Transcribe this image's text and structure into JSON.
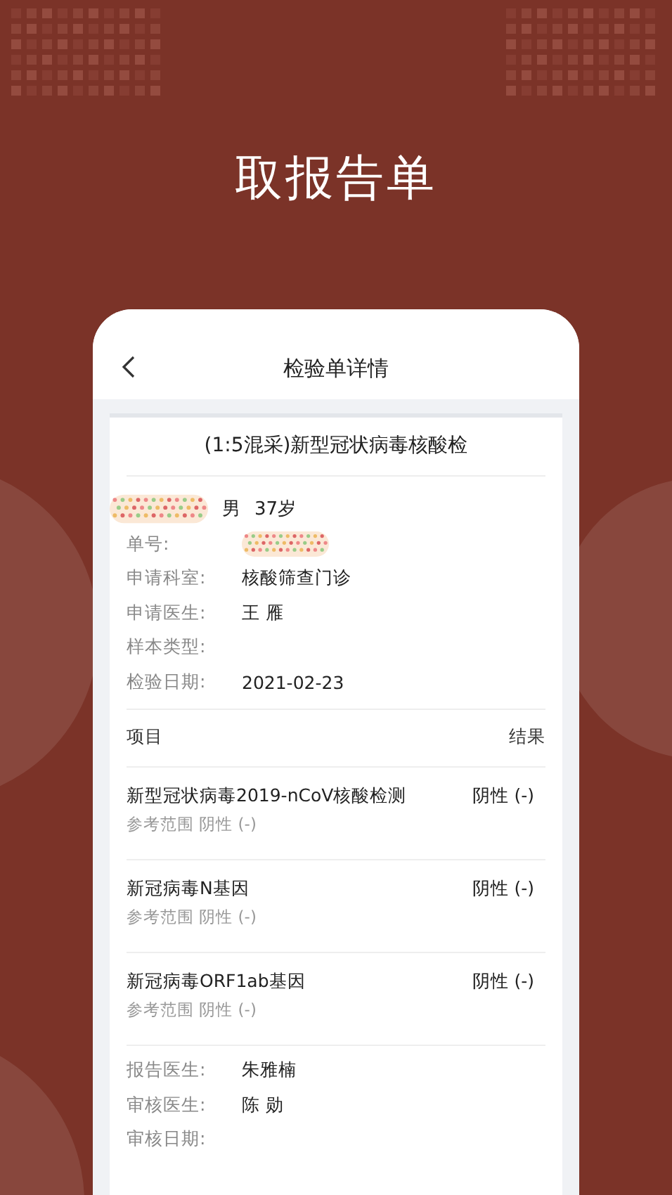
{
  "headline": "取报告单",
  "screen": {
    "title": "检验单详情",
    "report": {
      "title": "(1:5混采)新型冠状病毒核酸检",
      "patient": {
        "gender": "男",
        "age": "37岁"
      },
      "fields": [
        {
          "label": "单号:",
          "redacted": true
        },
        {
          "label": "申请科室:",
          "value": "核酸筛查门诊"
        },
        {
          "label": "申请医生:",
          "value": "王 雁"
        },
        {
          "label": "样本类型:"
        },
        {
          "label": "检验日期:",
          "value": "2021-02-23"
        }
      ],
      "columns": [
        "项目",
        "结果"
      ],
      "results": [
        {
          "name": "新型冠状病毒2019-nCoV核酸检测",
          "result": "阴性 (-)",
          "reference": "参考范围 阴性 (-)"
        },
        {
          "name": "新冠病毒N基因",
          "result": "阴性 (-)",
          "reference": "参考范围 阴性 (-)"
        },
        {
          "name": "新冠病毒ORF1ab基因",
          "result": "阴性 (-)",
          "reference": "参考范围 阴性 (-)"
        }
      ],
      "footer": [
        {
          "label": "报告医生:",
          "value": "朱雅楠"
        },
        {
          "label": "审核医生:",
          "value": "陈 勋"
        },
        {
          "label": "审核日期:"
        }
      ]
    }
  }
}
